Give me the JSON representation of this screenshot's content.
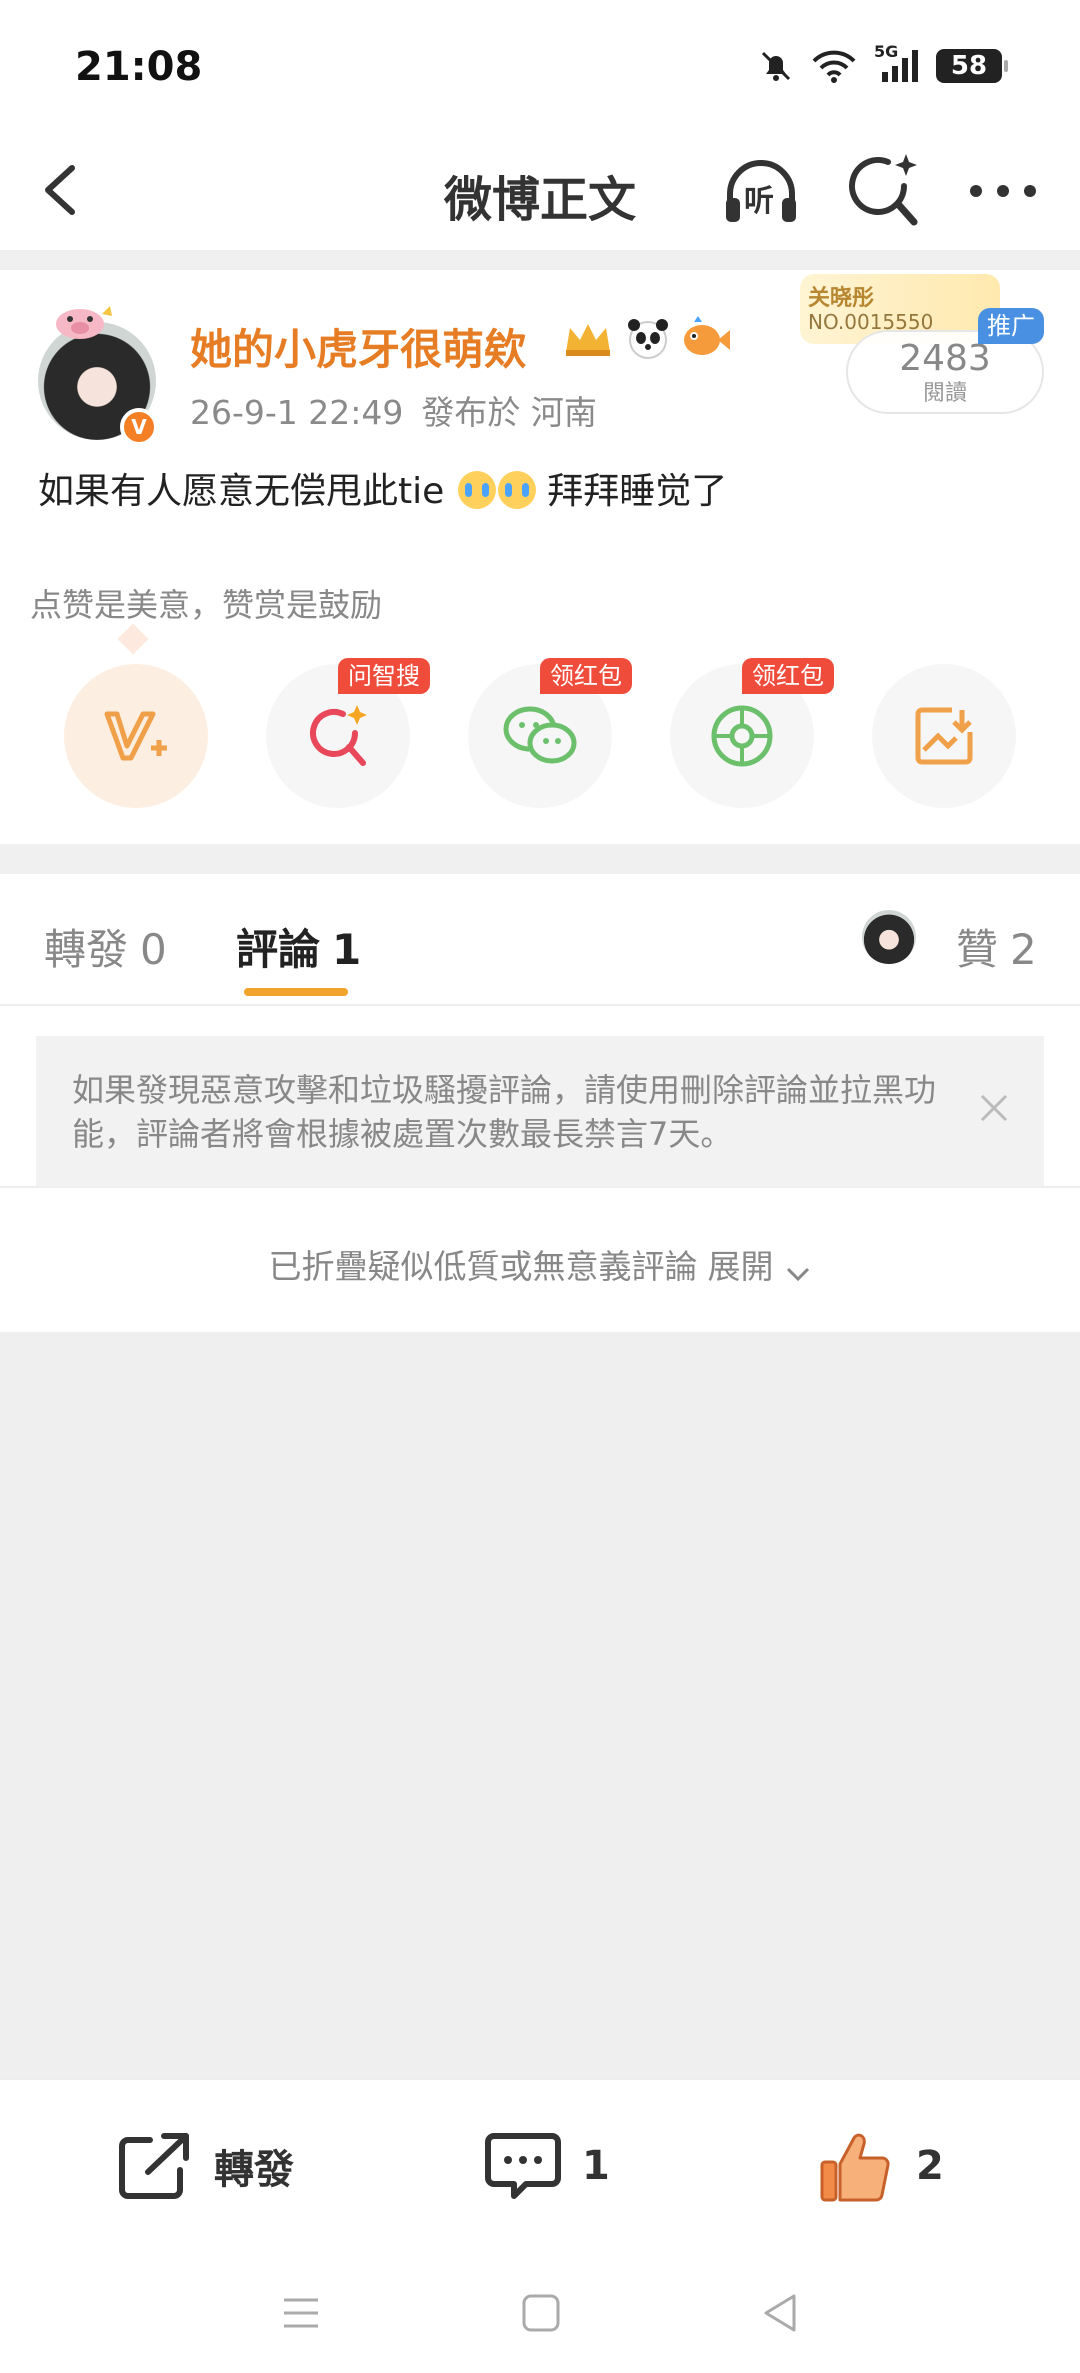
{
  "status_bar": {
    "time": "21:08",
    "network": "5G",
    "battery": "58"
  },
  "nav": {
    "title": "微博正文",
    "listen_label": "听"
  },
  "post": {
    "username": "她的小虎牙很萌欸",
    "verified_label": "V",
    "date": "26-9-1 22:49",
    "location": "發布於 河南",
    "fan_card": {
      "title": "关晓彤",
      "no": "NO.0015550"
    },
    "read_count": "2483",
    "read_label": "閱讀",
    "promo_tag": "推广",
    "text_before": "如果有人愿意无偿甩此tie",
    "text_after": " 拜拜睡觉了",
    "reward_tip": "点赞是美意，赞赏是鼓励"
  },
  "share_row": {
    "items": [
      {
        "icon": "reward-v-icon",
        "badge": ""
      },
      {
        "icon": "ai-search-icon",
        "badge": "问智搜"
      },
      {
        "icon": "wechat-icon",
        "badge": "领红包"
      },
      {
        "icon": "moments-icon",
        "badge": "领红包"
      },
      {
        "icon": "save-image-icon",
        "badge": ""
      }
    ]
  },
  "tabs": {
    "repost_label": "轉發",
    "repost_count": "0",
    "comment_label": "評論",
    "comment_count": "1",
    "like_label": "贊",
    "like_count": "2"
  },
  "notice": {
    "text": "如果發現惡意攻擊和垃圾騷擾評論，請使用刪除評論並拉黑功能，評論者將會根據被處置次數最長禁言7天。"
  },
  "folded": {
    "text": "已折疊疑似低質或無意義評論",
    "expand": "展開"
  },
  "bottom_bar": {
    "repost_label": "轉發",
    "comment_count": "1",
    "like_count": "2"
  },
  "colors": {
    "accent": "#e67c23",
    "tab_underline": "#f0a22a",
    "badge": "#f04c3c"
  }
}
